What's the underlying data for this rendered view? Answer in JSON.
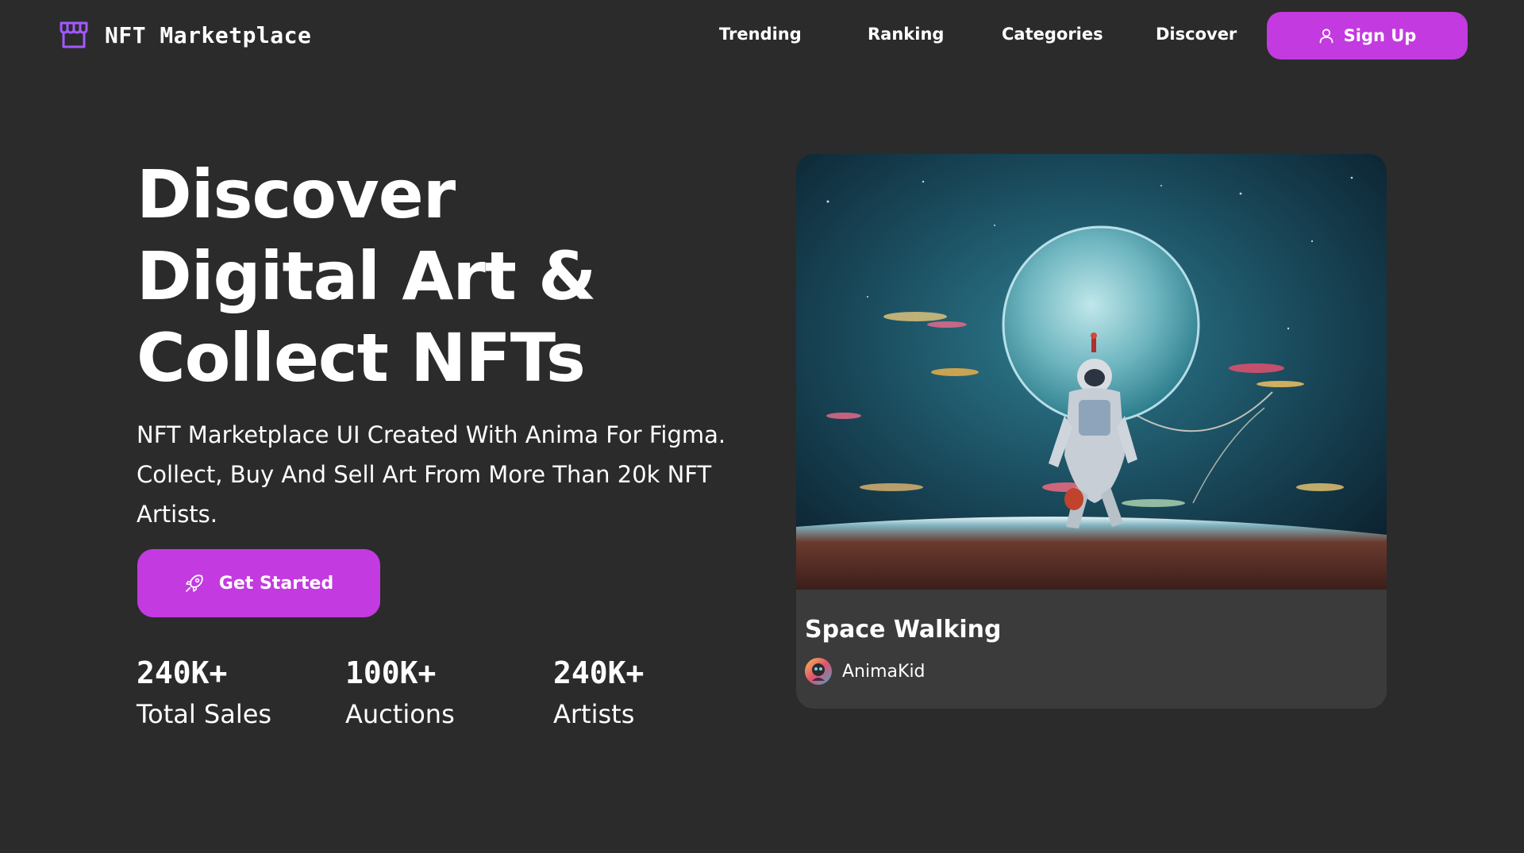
{
  "brand": {
    "name": "NFT Marketplace",
    "icon": "storefront-icon",
    "icon_color": "#a259ff"
  },
  "nav": {
    "links": [
      {
        "label": "Trending"
      },
      {
        "label": "Ranking"
      },
      {
        "label": "Categories"
      },
      {
        "label": "Discover"
      }
    ],
    "signup": {
      "label": "Sign Up",
      "icon": "user-icon"
    }
  },
  "hero": {
    "title_lines": [
      "Discover",
      "Digital Art &",
      "Collect NFTs"
    ],
    "subtitle": "NFT Marketplace UI Created With Anima For Figma. Collect, Buy And Sell Art From More Than 20k NFT Artists.",
    "cta": {
      "label": "Get Started",
      "icon": "rocket-icon"
    }
  },
  "stats": [
    {
      "value": "240K+",
      "label": "Total Sales"
    },
    {
      "value": "100K+",
      "label": "Auctions"
    },
    {
      "value": "240K+",
      "label": "Artists"
    }
  ],
  "featured_nft": {
    "image": "astronaut-planet-artwork",
    "title": "Space Walking",
    "artist": {
      "name": "AnimaKid",
      "avatar": "artist-avatar"
    }
  },
  "colors": {
    "background": "#2b2b2b",
    "card_background": "#3b3b3b",
    "accent": "#c33ae0",
    "text": "#ffffff"
  }
}
